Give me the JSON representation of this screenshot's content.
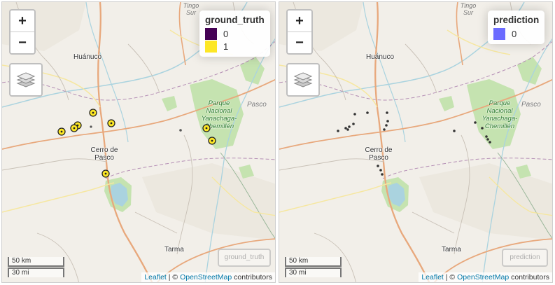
{
  "maps": [
    {
      "legend": {
        "title": "ground_truth",
        "entries": [
          {
            "label": "0",
            "color": "#440154"
          },
          {
            "label": "1",
            "color": "#fde725"
          }
        ]
      },
      "watermark": "ground_truth"
    },
    {
      "legend": {
        "title": "prediction",
        "entries": [
          {
            "label": "0",
            "color": "#6b6bff"
          }
        ]
      },
      "watermark": "prediction"
    }
  ],
  "places": {
    "huanuco": "Huánuco",
    "cerro_de_pasco_1": "Cerro de",
    "cerro_de_pasco_2": "Pasco",
    "tarma": "Tarma",
    "park_1": "Parque",
    "park_2": "Nacional",
    "park_3": "Yanachaga-",
    "park_4": "Chemillén",
    "pasco_region": "Pasco",
    "top_cut_1": "Tingo",
    "top_cut_2": "Sur"
  },
  "zoom": {
    "in": "+",
    "out": "−"
  },
  "scale": {
    "km": "50 km",
    "mi": "30 mi"
  },
  "attribution": {
    "leaflet": "Leaflet",
    "sep": " | © ",
    "osm": "OpenStreetMap",
    "suffix": " contributors"
  },
  "colors": {
    "positive": "#fde725",
    "negative": "#440154",
    "prediction": "#6b6bff",
    "marker_stroke": "#222222",
    "park": "#c5e3b0",
    "lake": "#aad3df"
  }
}
